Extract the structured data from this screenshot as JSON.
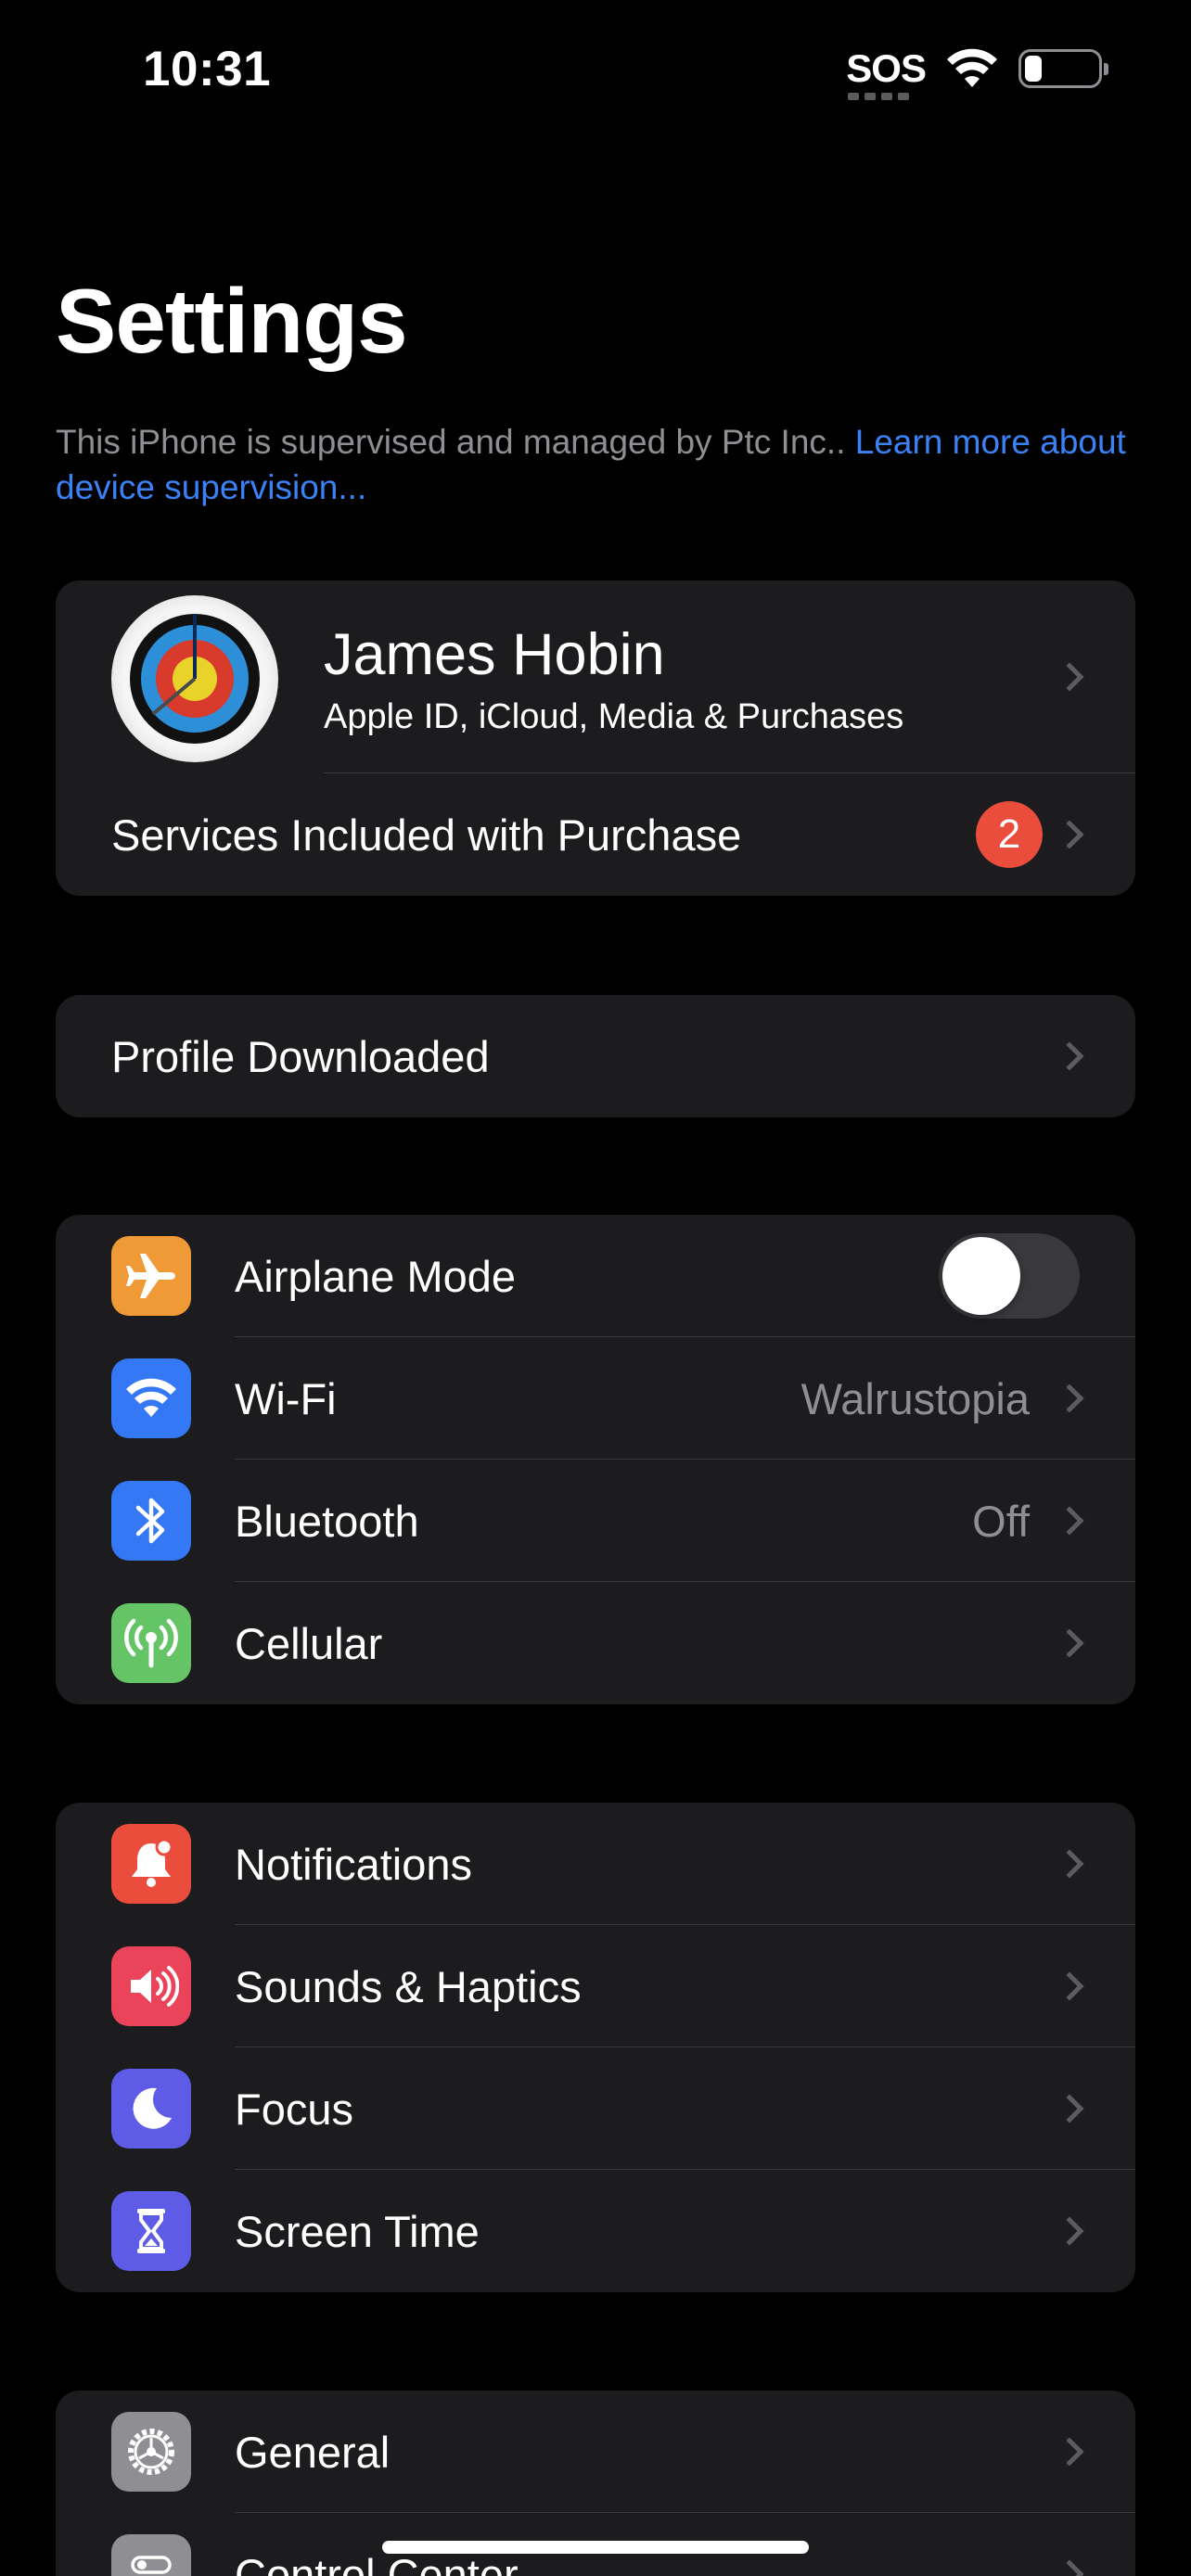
{
  "status_bar": {
    "time": "10:31",
    "carrier": "SOS",
    "wifi": "wifi-icon",
    "battery": "battery-low-icon"
  },
  "header": {
    "title": "Settings",
    "supervision_text": "This iPhone is supervised and managed by Ptc Inc.. ",
    "supervision_link": "Learn more about device supervision..."
  },
  "account": {
    "name": "James Hobin",
    "subtitle": "Apple ID, iCloud, Media & Purchases",
    "avatar": "archery-target-avatar",
    "services_label": "Services Included with Purchase",
    "services_badge": "2"
  },
  "profile": {
    "label": "Profile Downloaded"
  },
  "connectivity": [
    {
      "label": "Airplane Mode",
      "icon": "airplane-icon",
      "color": "#f09a37",
      "toggle": false
    },
    {
      "label": "Wi-Fi",
      "icon": "wifi-icon",
      "color": "#3478f6",
      "value": "Walrustopia"
    },
    {
      "label": "Bluetooth",
      "icon": "bluetooth-icon",
      "color": "#3478f6",
      "value": "Off"
    },
    {
      "label": "Cellular",
      "icon": "antenna-icon",
      "color": "#65c466"
    }
  ],
  "attention": [
    {
      "label": "Notifications",
      "icon": "bell-icon",
      "color": "#eb4d3d"
    },
    {
      "label": "Sounds & Haptics",
      "icon": "speaker-icon",
      "color": "#eb445a"
    },
    {
      "label": "Focus",
      "icon": "moon-icon",
      "color": "#5e5ce6"
    },
    {
      "label": "Screen Time",
      "icon": "hourglass-icon",
      "color": "#5e5ce6"
    }
  ],
  "system": [
    {
      "label": "General",
      "icon": "gear-icon",
      "color": "#8e8e93"
    },
    {
      "label": "Control Center",
      "icon": "switches-icon",
      "color": "#8e8e93"
    }
  ],
  "colors": {
    "background": "#000000",
    "group": "#1c1c1e",
    "link": "#3b82f6",
    "secondary_text": "#8e8e93",
    "badge": "#eb4d3d"
  }
}
